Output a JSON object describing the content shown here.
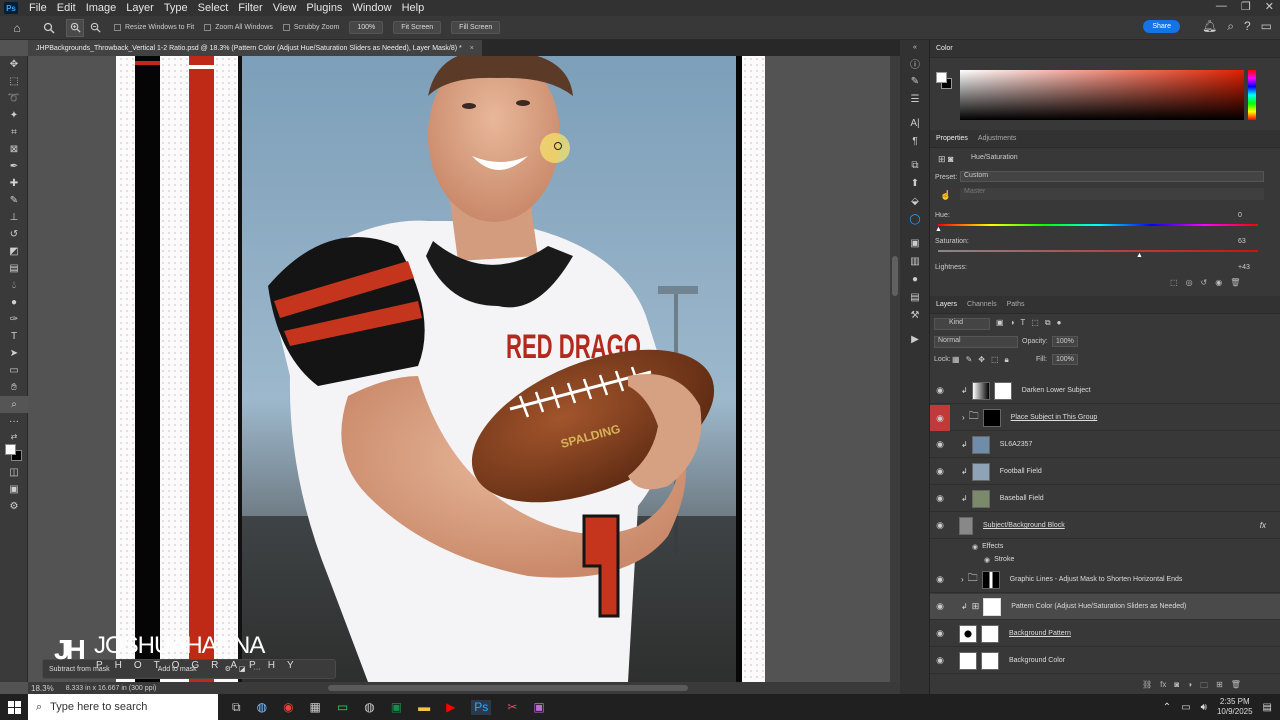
{
  "app": {
    "menu": [
      "File",
      "Edit",
      "Image",
      "Layer",
      "Type",
      "Select",
      "Filter",
      "View",
      "Plugins",
      "Window",
      "Help"
    ]
  },
  "options": {
    "resize_windows": "Resize Windows to Fit",
    "zoom_all": "Zoom All Windows",
    "scrubby_zoom": "Scrubby Zoom",
    "zoom_100": "100%",
    "fit_screen": "Fit Screen",
    "fill_screen": "Fill Screen",
    "share": "Share"
  },
  "document": {
    "tab_title": "JHPBackgrounds_Throwback_Vertical 1-2 Ratio.psd @ 18.3% (Pattern Color (Adjust Hue/Saturation Sliders as Needed), Layer Mask/8) *",
    "zoom": "18.3%",
    "dims": "8.333 in x 16.667 in (300 ppi)",
    "jersey_text": "RED DRAGO",
    "ball_brand": "SPALDING"
  },
  "mask_popup": {
    "subtract": "Subtract from mask",
    "add": "Add to mask"
  },
  "watermark": {
    "name": "JOSHUAHANNA",
    "sub": "PHOTOGRAPHY"
  },
  "color_panel": {
    "title": "Color"
  },
  "properties": {
    "tab1": "Properties",
    "tab2": "Adjustments",
    "adj_name": "Hue/Saturation",
    "preset_label": "Preset:",
    "preset_value": "Custom",
    "master": "Master",
    "hue_label": "Hue:",
    "hue_value": "0",
    "sat_label": "Saturation:",
    "sat_value": "63",
    "light_label": "Lightness:",
    "light_value": "+43"
  },
  "layers_panel": {
    "tab1": "Layers",
    "tab2": "Channels",
    "tab3": "Paths",
    "kind": "Kind",
    "blend": "Normal",
    "opacity_label": "Opacity:",
    "opacity_value": "100%",
    "lock_label": "Lock:",
    "fill_label": "Fill:",
    "fill_value": "100%",
    "layers": [
      {
        "name": "Darken Lower Subject"
      },
      {
        "name": "Place Subject in This Group"
      },
      {
        "name": "SL6A2357"
      },
      {
        "name": "Football Field"
      },
      {
        "name": "Baseball Field"
      },
      {
        "name": "Subject/Background Block"
      },
      {
        "name": "Effects"
      },
      {
        "name": "Stroke"
      },
      {
        "name": "Graphic Lines - Adjust Mask to Shorten Horizontal Ends"
      },
      {
        "name": "Pattern Color (Adjust Hue/Saturation Sliders as Needed)"
      },
      {
        "name": "Background Pattern"
      },
      {
        "name": "Background Color"
      }
    ]
  },
  "taskbar": {
    "search": "Type here to search",
    "time": "2:35 PM",
    "date": "10/9/2025"
  }
}
